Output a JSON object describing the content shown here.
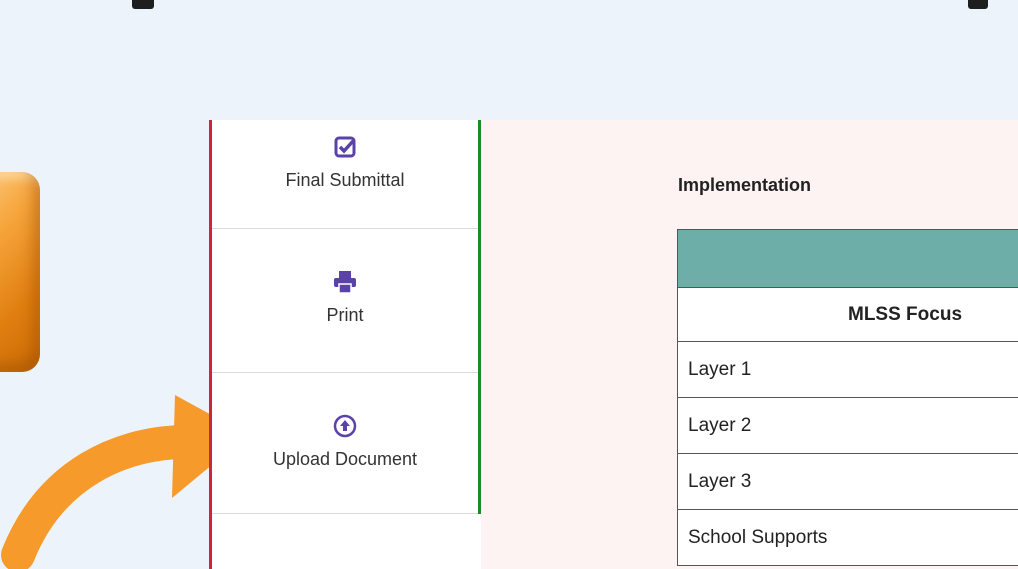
{
  "sidebar": {
    "items": [
      {
        "label": "Final Submittal",
        "icon": "checkbox-check-icon"
      },
      {
        "label": "Print",
        "icon": "printer-icon"
      },
      {
        "label": "Upload Document",
        "icon": "upload-circle-icon"
      }
    ]
  },
  "main": {
    "section_title": "Implementation",
    "table": {
      "header": "MLSS Focus",
      "rows": [
        "Layer 1",
        "Layer 2",
        "Layer 3",
        "School Supports"
      ]
    }
  },
  "colors": {
    "accent_purple": "#5b42a8",
    "sidebar_left_border": "#c8283a",
    "sidebar_right_border": "#1e8b2b",
    "table_header_teal": "#6eaea9",
    "arrow_orange": "#f59a2b"
  }
}
